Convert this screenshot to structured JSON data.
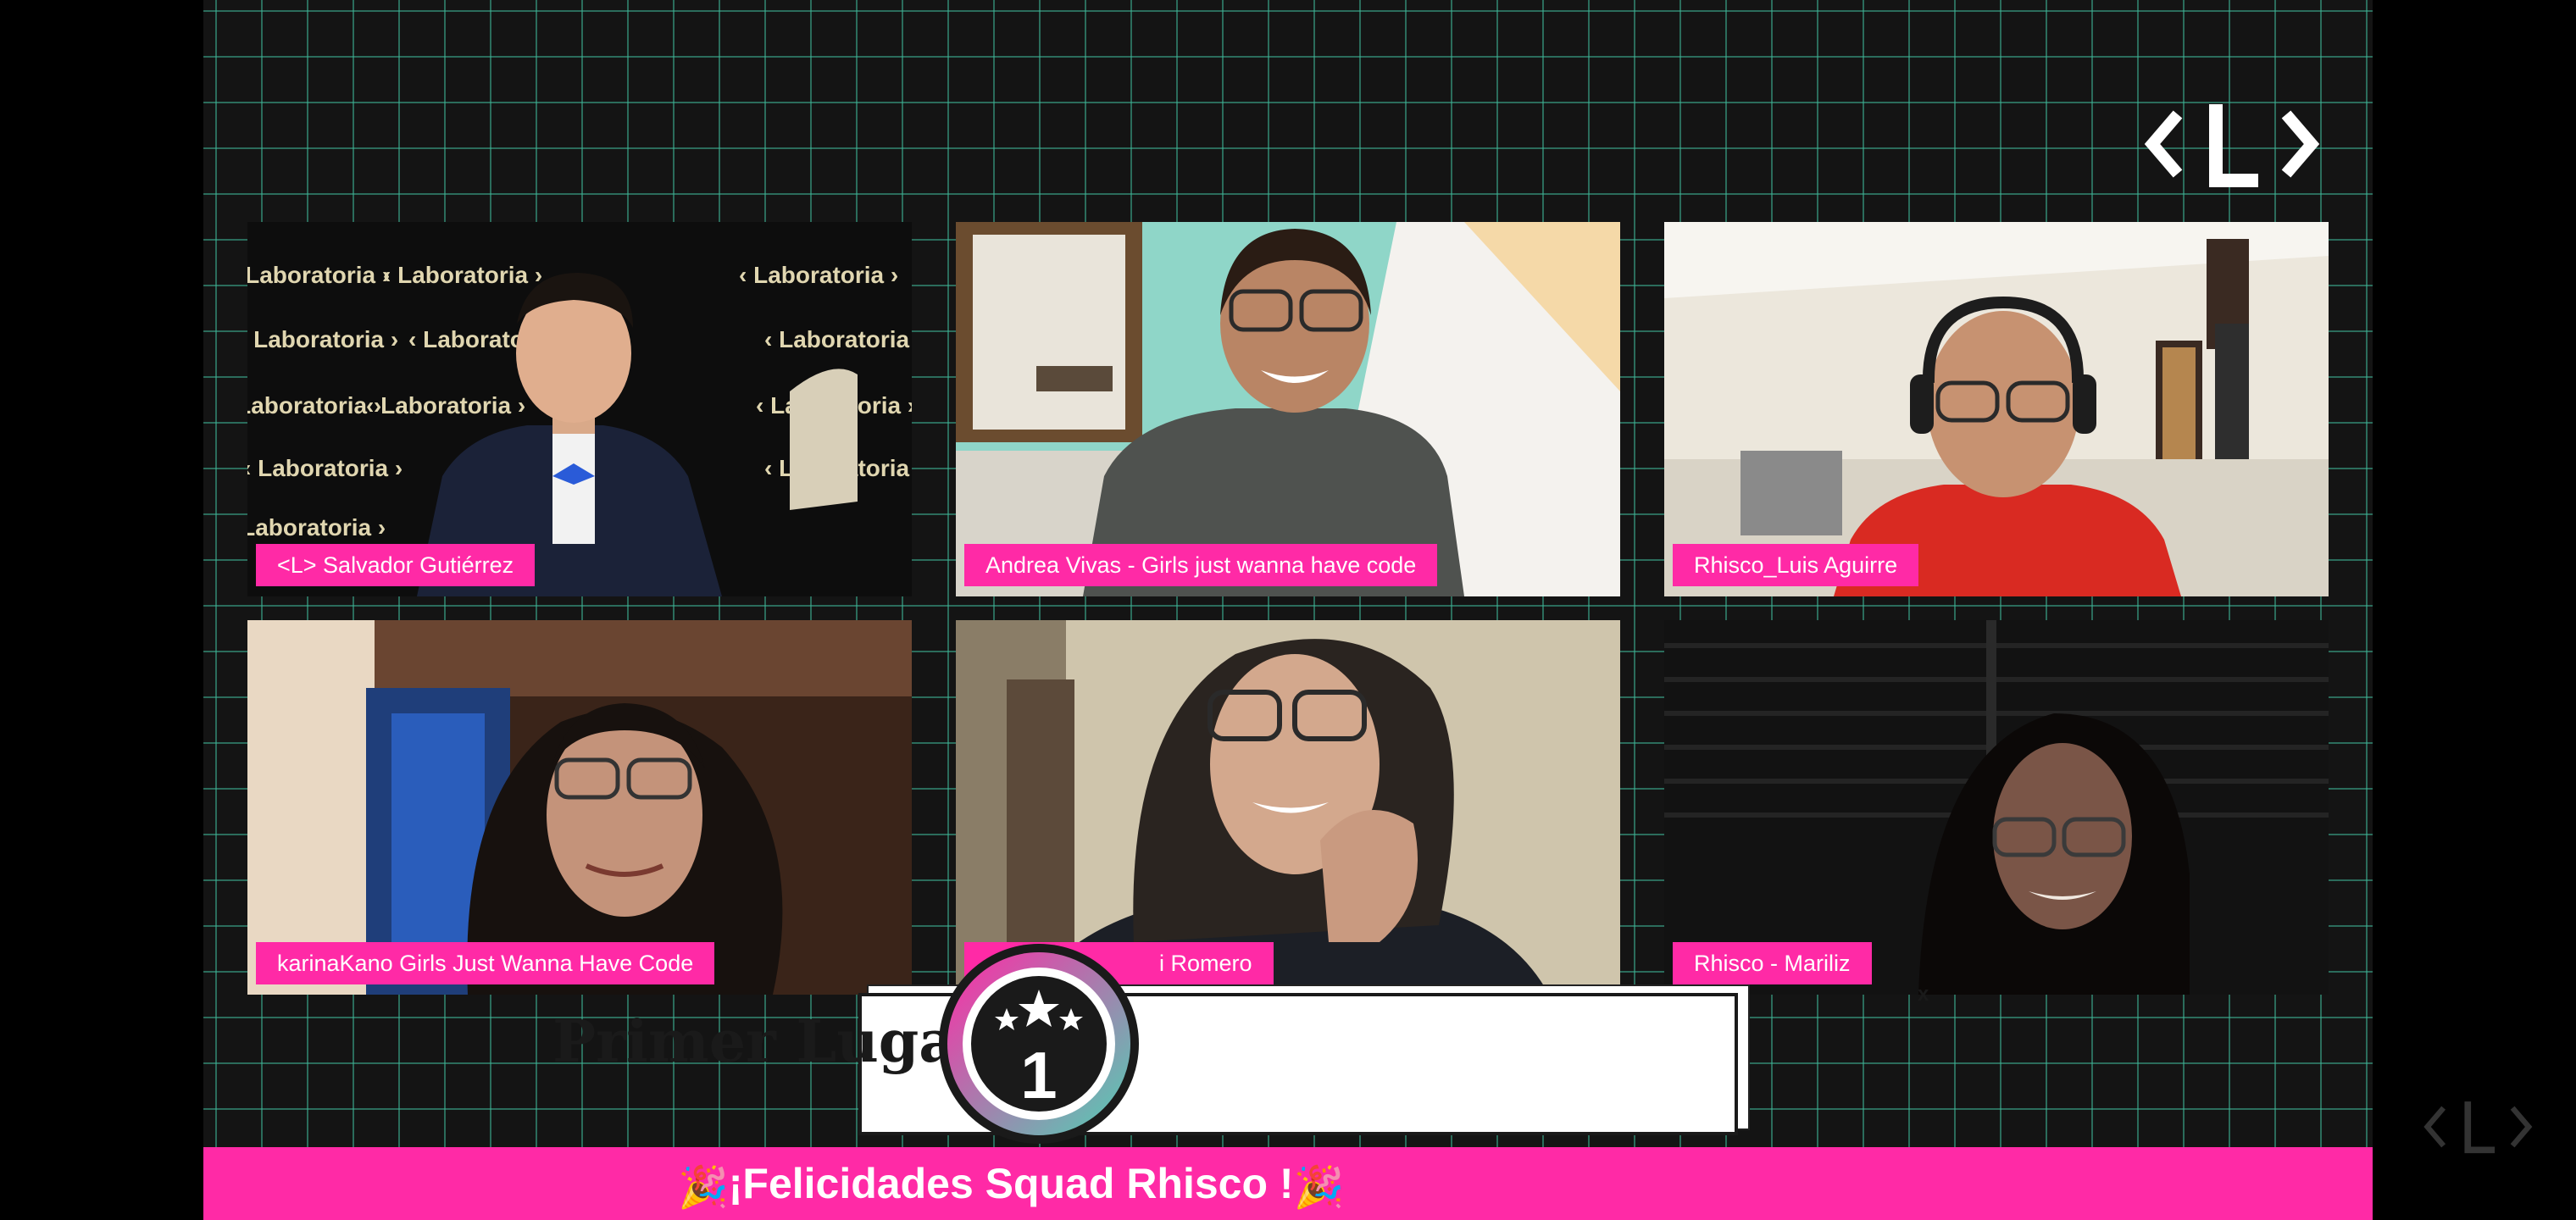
{
  "brand": {
    "logo_icon": "laboratoria-bracket-L-logo"
  },
  "participants": [
    {
      "name": "<L> Salvador Gutiérrez",
      "backdrop_text": "‹ Laboratoria ›"
    },
    {
      "name": "Andrea Vivas - Girls just wanna have code"
    },
    {
      "name": "Rhisco_Luis Aguirre"
    },
    {
      "name": "karinaKano Girls Just Wanna Have Code"
    },
    {
      "name": "i Romero"
    },
    {
      "name": "Rhisco - Mariliz"
    }
  ],
  "award": {
    "title": "Primer Lugar",
    "rank": "1",
    "close": "x",
    "medal_icon": "three-star-medal-icon"
  },
  "ticker": {
    "text": "¡Felicidades Squad Rhisco !",
    "icon": "party-popper-icon"
  },
  "colors": {
    "accent_pink": "#ff2aa6",
    "grid_green": "#3eb496",
    "background": "#141414"
  }
}
